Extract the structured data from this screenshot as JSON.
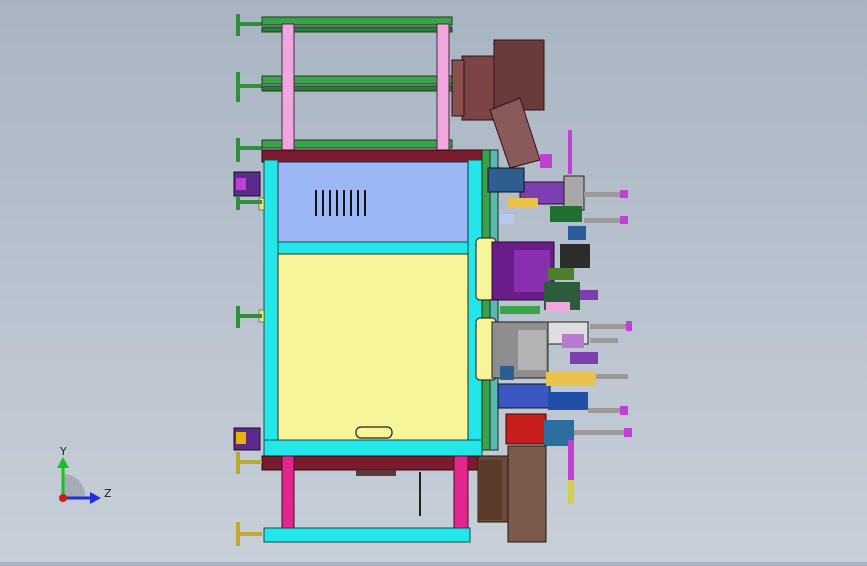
{
  "viewport": {
    "background_top": "#a9b4c2",
    "background_bottom": "#c7cfd8"
  },
  "triad": {
    "y_label": "Y",
    "z_label": "Z",
    "y_color": "#18c21f",
    "z_color": "#1f2fe0",
    "origin_color": "#d01818"
  },
  "colors": {
    "cabinet_blue_panel": "#9cb7f5",
    "cabinet_yellow_panel": "#f6f59a",
    "cabinet_frame_cyan": "#22e6e8",
    "frame_maroon": "#7a1b2e",
    "rail_green": "#2f8f3a",
    "post_pink": "#f2a6e0",
    "post_magenta": "#e3268e",
    "motor_brown": "#6b3a3a",
    "drum_gray": "#8e8e8e",
    "purple_unit": "#6a1c8a"
  }
}
